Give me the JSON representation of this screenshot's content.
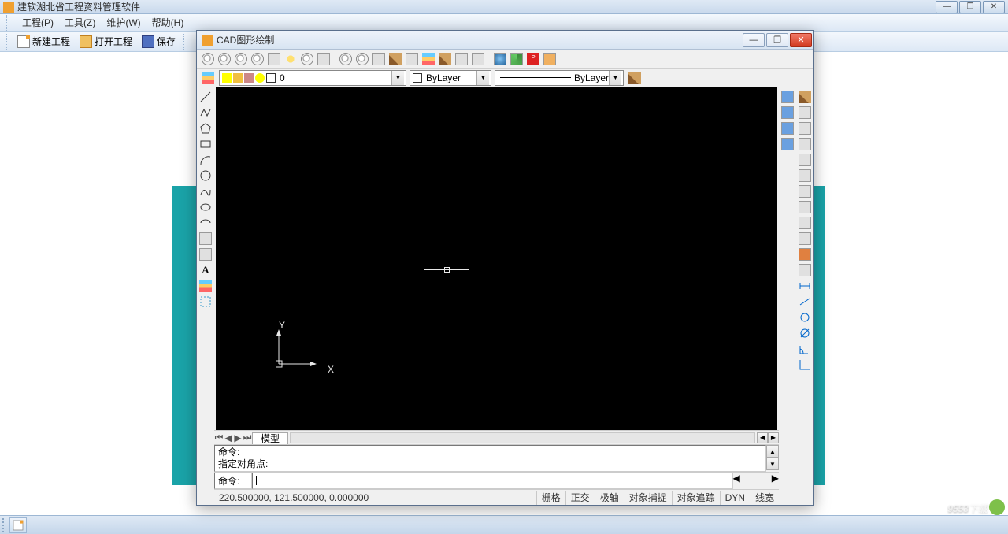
{
  "main": {
    "title": "建软湖北省工程资料管理软件",
    "menus": {
      "project": "工程(P)",
      "tools": "工具(Z)",
      "maintain": "维护(W)",
      "help": "帮助(H)"
    },
    "toolbar": {
      "new_label": "新建工程",
      "open_label": "打开工程",
      "save_label": "保存"
    }
  },
  "cad": {
    "title": "CAD图形绘制",
    "layer_dropdown_value": "0",
    "color_dropdown_value": "ByLayer",
    "lineweight_dropdown_value": "ByLayer",
    "tab_model": "模型",
    "cmd_history_line1": "命令:",
    "cmd_history_line2": "指定对角点:",
    "cmd_prompt": "命令:",
    "cmd_input_value": "",
    "coords": "220.500000,  121.500000,  0.000000",
    "status_modes": {
      "grid": "栅格",
      "ortho": "正交",
      "polar": "极轴",
      "osnap": "对象捕捉",
      "otrack": "对象追踪",
      "dyn": "DYN",
      "lw": "线宽"
    },
    "ucs": {
      "x": "X",
      "y": "Y"
    }
  },
  "watermark": "9553"
}
